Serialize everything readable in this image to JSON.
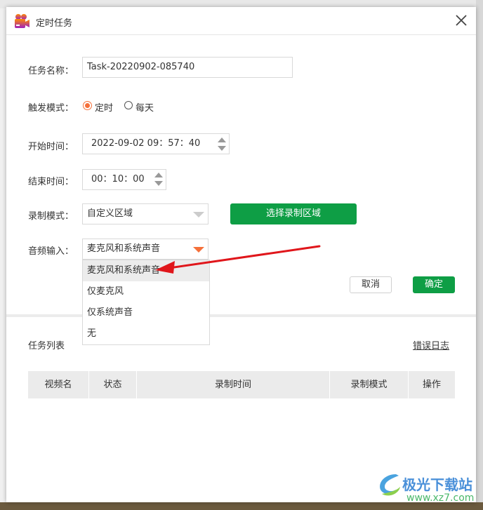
{
  "dialog": {
    "title": "定时任务",
    "close_icon": "close-icon",
    "app_icon": "video-camera-icon"
  },
  "form": {
    "task_name_label": "任务名称：",
    "task_name_value": "Task-20220902-085740",
    "trigger_label": "触发模式：",
    "trigger_options": [
      "定时",
      "每天"
    ],
    "trigger_selected": "定时",
    "start_label": "开始时间：",
    "start_value": "2022-09-02 09：57：40",
    "end_label": "结束时间：",
    "end_value": "00：10：00",
    "record_mode_label": "录制模式：",
    "record_mode_value": "自定义区域",
    "select_area_button": "选择录制区域",
    "audio_label": "音频输入：",
    "audio_value": "麦克风和系统声音",
    "audio_options": [
      "麦克风和系统声音",
      "仅麦克风",
      "仅系统声音",
      "无"
    ],
    "cancel": "取消",
    "ok": "确定"
  },
  "tasks": {
    "title": "任务列表",
    "error_log": "错误日志",
    "columns": [
      "视频名",
      "状态",
      "录制时间",
      "录制模式",
      "操作"
    ]
  },
  "watermark": {
    "name": "极光下载站",
    "url": "www.xz7.com"
  },
  "colors": {
    "accent_green": "#0e9e45",
    "accent_orange": "#f5703a",
    "arrow_red": "#e0161b"
  }
}
